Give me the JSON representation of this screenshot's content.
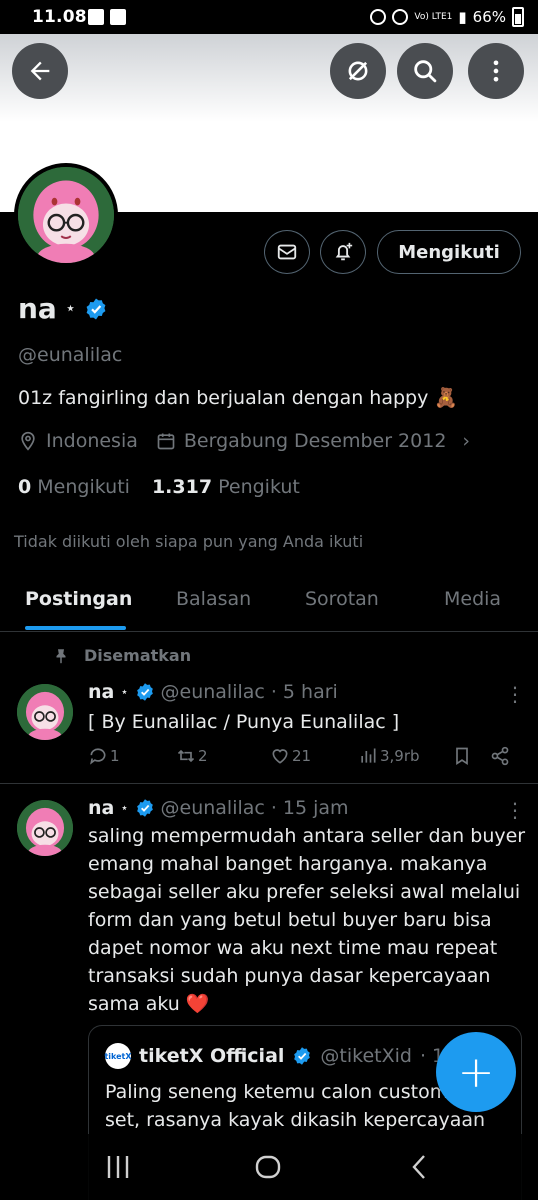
{
  "status": {
    "time": "11.08",
    "network": "Vo) LTE1",
    "battery": "66%"
  },
  "profile": {
    "name": "na",
    "star": "⋆",
    "handle": "@eunalilac",
    "bio": "01z fangirling dan berjualan dengan happy 🧸",
    "location": "Indonesia",
    "joined": "Bergabung Desember 2012",
    "following_count": "0",
    "following_label": "Mengikuti",
    "followers_count": "1.317",
    "followers_label": "Pengikut",
    "not_followed_note": "Tidak diikuti oleh siapa pun yang Anda ikuti",
    "follow_button": "Mengikuti"
  },
  "tabs": [
    {
      "label": "Postingan",
      "active": true
    },
    {
      "label": "Balasan",
      "active": false
    },
    {
      "label": "Sorotan",
      "active": false
    },
    {
      "label": "Media",
      "active": false
    }
  ],
  "pinned_label": "Disematkan",
  "posts": [
    {
      "name": "na",
      "star": "⋆",
      "handle": "@eunalilac",
      "time": "· 5 hari",
      "text": "[ By Eunalilac / Punya Eunalilac ]",
      "replies": "1",
      "reposts": "2",
      "likes": "21",
      "views": "3,9rb"
    },
    {
      "name": "na",
      "star": "⋆",
      "handle": "@eunalilac",
      "time": "· 15 jam",
      "text": "saling mempermudah antara seller dan buyer\nemang mahal banget harganya. makanya\nsebagai seller aku prefer seleksi awal melalui\nform dan yang betul betul buyer baru bisa\ndapet nomor wa aku next time mau repeat\ntransaksi sudah punya dasar kepercayaan\nsama aku ❤️",
      "quote": {
        "logo_text": "tiketX",
        "name": "tiketX Official",
        "handle": "@tiketXid",
        "time": "· 1 h",
        "text": "Paling seneng ketemu calon custom\nset, rasanya kayak dikasih kepercayaan"
      }
    }
  ],
  "fab_symbol": "+",
  "icons": {
    "back": "arrow-left-icon",
    "grok": "slash-circle-icon",
    "search": "search-icon",
    "more": "more-vertical-icon",
    "message": "mail-icon",
    "notify": "bell-plus-icon",
    "location": "location-pin-icon",
    "calendar": "calendar-icon",
    "verified": "verified-badge-icon",
    "pin": "pin-icon"
  },
  "colors": {
    "accent": "#1d9bf0",
    "background": "#000000",
    "muted": "#71767b"
  }
}
